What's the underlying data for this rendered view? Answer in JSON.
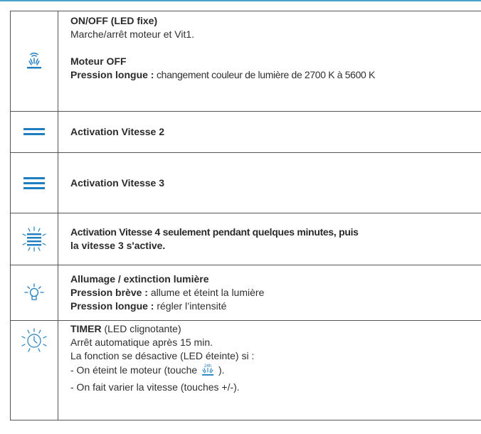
{
  "rows": [
    {
      "icon": "fan-power-icon",
      "title": "ON/OFF (LED fixe)",
      "line1": "Marche/arrêt moteur et Vit1.",
      "heading2": "Moteur OFF",
      "long_press_label": "Pression longue :",
      "long_press_text": " changement couleur de lumière de 2700 K à 5600 K"
    },
    {
      "icon": "two-bars-icon",
      "text": "Activation Vitesse 2"
    },
    {
      "icon": "three-bars-icon",
      "text": "Activation Vitesse 3"
    },
    {
      "icon": "four-bars-rays-icon",
      "line1": "Activation Vitesse 4 seulement pendant quelques minutes, puis",
      "line2": "la vitesse 3 s'active."
    },
    {
      "icon": "light-bulb-icon",
      "title": "Allumage / extinction lumière",
      "short_label": "Pression brève :",
      "short_text": " allume et éteint la lumière",
      "long_label": "Pression longue :",
      "long_text": " régler l’intensité"
    },
    {
      "icon": "timer-clock-icon",
      "title_bold": "TIMER",
      "title_rest": " (LED clignotante)",
      "line1": "Arrêt automatique après 15 min.",
      "line2": "La fonction se désactive (LED éteinte) si :",
      "line3_before": "- On éteint le moteur (touche ",
      "line3_icon_text": "24h",
      "line3_after": " ).",
      "line4": "- On fait varier la vitesse (touches +/-)."
    }
  ],
  "colors": {
    "icon_blue": "#1f7ec0",
    "border": "#555555",
    "top_line": "#4aa3cc"
  }
}
